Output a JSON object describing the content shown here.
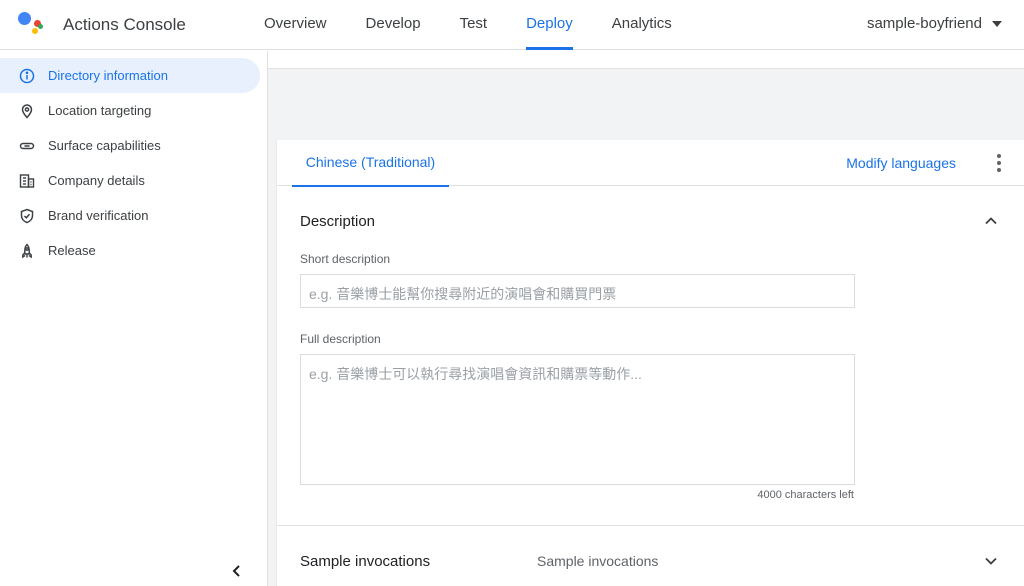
{
  "app": {
    "title": "Actions Console"
  },
  "nav": {
    "tabs": [
      {
        "label": "Overview"
      },
      {
        "label": "Develop"
      },
      {
        "label": "Test"
      },
      {
        "label": "Deploy",
        "active": true
      },
      {
        "label": "Analytics"
      }
    ]
  },
  "project": {
    "name": "sample-boyfriend"
  },
  "sidebar": {
    "items": [
      {
        "label": "Directory information",
        "icon": "info-icon",
        "active": true
      },
      {
        "label": "Location targeting",
        "icon": "location-pin-icon"
      },
      {
        "label": "Surface capabilities",
        "icon": "link-icon"
      },
      {
        "label": "Company details",
        "icon": "building-icon"
      },
      {
        "label": "Brand verification",
        "icon": "shield-check-icon"
      },
      {
        "label": "Release",
        "icon": "rocket-icon"
      }
    ]
  },
  "card": {
    "language_tab": "Chinese (Traditional)",
    "modify_languages": "Modify languages",
    "description": {
      "title": "Description",
      "short_label": "Short description",
      "short_placeholder": "e.g. 音樂博士能幫你搜尋附近的演唱會和購買門票",
      "full_label": "Full description",
      "full_placeholder": "e.g. 音樂博士可以執行尋找演唱會資訊和購票等動作...",
      "counter": "4000 characters left"
    },
    "sample_invocations": {
      "title": "Sample invocations",
      "subtitle": "Sample invocations"
    }
  },
  "colors": {
    "accent": "#1a73e8",
    "active_bg": "#e8f0fe"
  }
}
